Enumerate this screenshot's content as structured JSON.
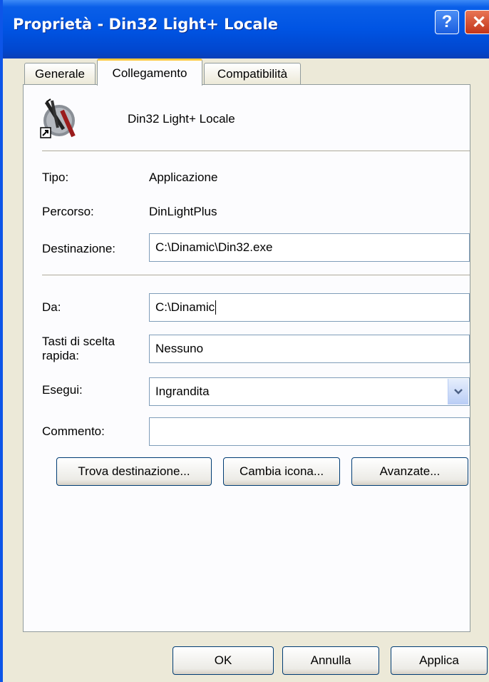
{
  "window": {
    "title": "Proprietà - Din32 Light+ Locale"
  },
  "titlebar": {
    "help_label": "?",
    "close_label": "✕"
  },
  "tabs": [
    {
      "label": "Generale",
      "active": false
    },
    {
      "label": "Collegamento",
      "active": true
    },
    {
      "label": "Compatibilità",
      "active": false
    }
  ],
  "shortcut": {
    "name": "Din32 Light+ Locale",
    "icon": "shortcut-app-icon"
  },
  "fields": {
    "tipo_label": "Tipo:",
    "tipo_value": "Applicazione",
    "percorso_label": "Percorso:",
    "percorso_value": "DinLightPlus",
    "destinazione_label": "Destinazione:",
    "destinazione_value": "C:\\Dinamic\\Din32.exe",
    "da_label": "Da:",
    "da_value": "C:\\Dinamic",
    "tasti_label_1": "Tasti di scelta",
    "tasti_label_2": "rapida:",
    "tasti_value": "Nessuno",
    "esegui_label": "Esegui:",
    "esegui_value": "Ingrandita",
    "commento_label": "Commento:",
    "commento_value": ""
  },
  "actions": {
    "trova_label": "Trova destinazione...",
    "cambia_label": "Cambia icona...",
    "avanzate_label": "Avanzate..."
  },
  "footer": {
    "ok_label": "OK",
    "annulla_label": "Annulla",
    "applica_label": "Applica"
  },
  "colors": {
    "titlebar": "#0054e3",
    "tab_highlight": "#ffc83c",
    "dialog_bg": "#ece9d8"
  }
}
